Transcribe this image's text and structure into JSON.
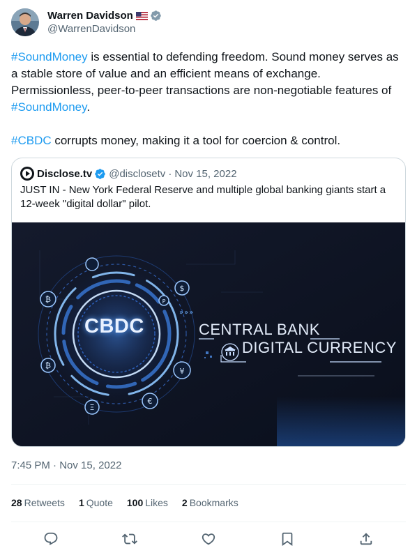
{
  "author": {
    "display_name": "Warren Davidson",
    "handle": "@WarrenDavidson",
    "flag": "us-flag",
    "verified": "verified-badge",
    "verified_color": "#829aab"
  },
  "tweet": {
    "para1": [
      {
        "text": "#SoundMoney",
        "hashtag": true
      },
      {
        "text": " is essential to defending freedom. Sound money serves as a stable store of value and an efficient means of exchange. Permissionless, peer-to-peer transactions are non-negotiable features of ",
        "hashtag": false
      },
      {
        "text": "#SoundMoney",
        "hashtag": true
      },
      {
        "text": ".",
        "hashtag": false
      }
    ],
    "para2": [
      {
        "text": "#CBDC",
        "hashtag": true
      },
      {
        "text": " corrupts money, making it a tool for coercion & control.",
        "hashtag": false
      }
    ],
    "link_color": "#1d9bf0"
  },
  "quote": {
    "display_name": "Disclose.tv",
    "handle": "@disclosetv",
    "separator": "·",
    "date": "Nov 15, 2022",
    "verified_color": "#1d9bf0",
    "text": "JUST IN - New York Federal Reserve and multiple global banking giants start a 12-week \"digital dollar\" pilot.",
    "media": {
      "center_label": "CBDC",
      "line1": "CENTRAL BANK",
      "line2": "DIGITAL CURRENCY"
    }
  },
  "meta": {
    "time": "7:45 PM",
    "separator": "·",
    "date": "Nov 15, 2022"
  },
  "stats": {
    "retweets_count": "28",
    "retweets_label": "Retweets",
    "quotes_count": "1",
    "quotes_label": "Quote",
    "likes_count": "100",
    "likes_label": "Likes",
    "bookmarks_count": "2",
    "bookmarks_label": "Bookmarks"
  },
  "actions": [
    "reply-icon",
    "retweet-icon",
    "like-icon",
    "bookmark-icon",
    "share-icon"
  ],
  "colors": {
    "text": "#0f1419",
    "secondary": "#536471",
    "border": "#cfd9de",
    "divider": "#eff3f4"
  }
}
